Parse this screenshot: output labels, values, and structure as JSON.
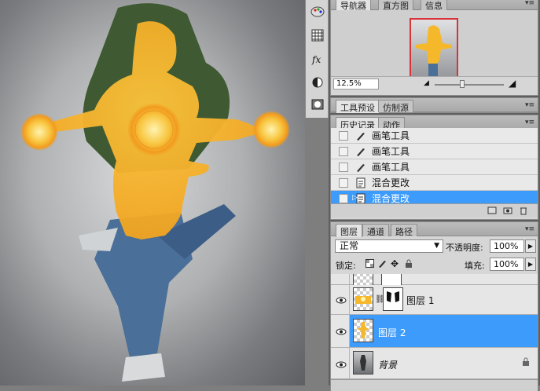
{
  "navigator": {
    "tabs": [
      "导航器",
      "直方图",
      "信息"
    ],
    "zoom_value": "12.5%"
  },
  "tool_presets": {
    "tabs": [
      "工具预设",
      "仿制源"
    ]
  },
  "history": {
    "tabs": [
      "历史记录",
      "动作"
    ],
    "items": [
      {
        "label": "画笔工具",
        "icon": "brush-icon",
        "selected": false
      },
      {
        "label": "画笔工具",
        "icon": "brush-icon",
        "selected": false
      },
      {
        "label": "画笔工具",
        "icon": "brush-icon",
        "selected": false
      },
      {
        "label": "混合更改",
        "icon": "document-icon",
        "selected": false
      },
      {
        "label": "混合更改",
        "icon": "document-icon",
        "selected": true
      }
    ]
  },
  "layers": {
    "tabs": [
      "图层",
      "通道",
      "路径"
    ],
    "blend_mode": "正常",
    "opacity_label": "不透明度:",
    "opacity_value": "100%",
    "lock_label": "锁定:",
    "fill_label": "填充:",
    "fill_value": "100%",
    "items": [
      {
        "name": "",
        "selected": false
      },
      {
        "name": "图层 1",
        "selected": false
      },
      {
        "name": "图层 2",
        "selected": true
      },
      {
        "name": "背景",
        "selected": false
      }
    ]
  },
  "colors": {
    "selection": "#3d9bfb",
    "glow": "#f8b526",
    "nav_frame": "#d9333a"
  }
}
